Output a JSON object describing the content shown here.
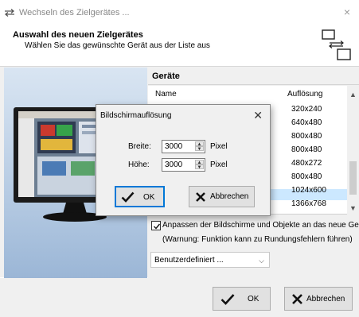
{
  "window": {
    "title": "Wechseln des Zielgerätes ...",
    "close_glyph": "×"
  },
  "header": {
    "title": "Auswahl des neuen Zielgerätes",
    "subtitle": "Wählen Sie das gewünschte Gerät aus der Liste aus"
  },
  "devices": {
    "section_title": "Geräte",
    "columns": {
      "name": "Name",
      "resolution": "Auflösung"
    },
    "resolutions": [
      "320x240",
      "640x480",
      "800x480",
      "800x480",
      "480x272",
      "800x480",
      "1024x600",
      "1366x768"
    ]
  },
  "adjust": {
    "checked": true,
    "label": "Anpassen der Bildschirme und Objekte an das neue Gerät",
    "warning": "(Warnung: Funktion kann zu Rundungsfehlern führen)"
  },
  "dropdown": {
    "value": "Benutzerdefiniert ..."
  },
  "footer": {
    "ok_label": "OK",
    "cancel_label": "Abbrechen"
  },
  "dialog": {
    "title": "Bildschirmauflösung",
    "close_glyph": "✕",
    "width_label": "Breite:",
    "width_value": "3000",
    "height_label": "Höhe:",
    "height_value": "3000",
    "unit": "Pixel",
    "ok_label": "OK",
    "cancel_label": "Abbrechen"
  },
  "colors": {
    "accent": "#0078d7",
    "selection": "#cce8ff"
  }
}
